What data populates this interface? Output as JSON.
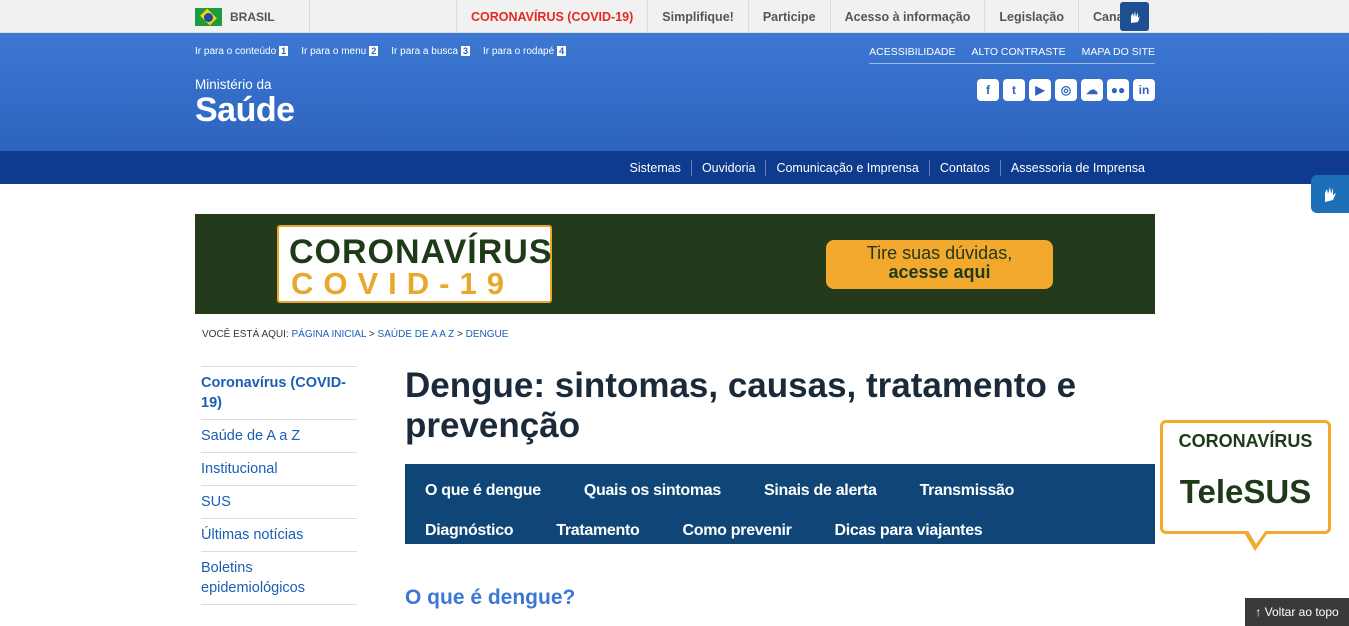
{
  "gov_bar": {
    "country": "BRASIL",
    "links": [
      {
        "label": "CORONAVÍRUS (COVID-19)"
      },
      {
        "label": "Simplifique!"
      },
      {
        "label": "Participe"
      },
      {
        "label": "Acesso à informação"
      },
      {
        "label": "Legislação"
      },
      {
        "label": "Canais"
      }
    ]
  },
  "skip_links": [
    {
      "label": "Ir para o conteúdo",
      "key": "1"
    },
    {
      "label": "Ir para o menu",
      "key": "2"
    },
    {
      "label": "Ir para a busca",
      "key": "3"
    },
    {
      "label": "Ir para o rodapé",
      "key": "4"
    }
  ],
  "access_links": [
    "ACESSIBILIDADE",
    "ALTO CONTRASTE",
    "MAPA DO SITE"
  ],
  "brand": {
    "small": "Ministério da",
    "big": "Saúde"
  },
  "social_icons": [
    "facebook-icon",
    "twitter-icon",
    "youtube-icon",
    "instagram-icon",
    "soundcloud-icon",
    "flickr-icon",
    "linkedin-icon"
  ],
  "social_glyphs": [
    "f",
    "t",
    "▶",
    "◎",
    "☁",
    "●●",
    "in"
  ],
  "main_nav": [
    "Sistemas",
    "Ouvidoria",
    "Comunicação e Imprensa",
    "Contatos",
    "Assessoria de Imprensa"
  ],
  "banner": {
    "line1": "CORONAVÍRUS",
    "line2": "COVID-19",
    "button_line1": "Tire suas dúvidas,",
    "button_line2": "acesse aqui"
  },
  "breadcrumb": {
    "prefix": "VOCÊ ESTÁ AQUI:",
    "items": [
      "PÁGINA INICIAL",
      "SAÚDE DE A A Z",
      "DENGUE"
    ],
    "separator": ">"
  },
  "sidebar": [
    {
      "label": "Coronavírus (COVID-19)",
      "active": true
    },
    {
      "label": "Saúde de A a Z"
    },
    {
      "label": "Institucional"
    },
    {
      "label": "SUS"
    },
    {
      "label": "Últimas notícias"
    },
    {
      "label": "Boletins epidemiológicos"
    }
  ],
  "page_title": "Dengue: sintomas, causas, tratamento e prevenção",
  "tabs_row1": [
    "O que é dengue",
    "Quais os sintomas",
    "Sinais de alerta",
    "Transmissão"
  ],
  "tabs_row2": [
    "Diagnóstico",
    "Tratamento",
    "Como prevenir",
    "Dicas para viajantes"
  ],
  "section_heading": "O que é dengue?",
  "telesus": {
    "line1": "CORONAVÍRUS",
    "line2": "TeleSUS"
  },
  "back_to_top": "↑ Voltar ao topo",
  "colors": {
    "header_blue": "#2d63bf",
    "nav_dark": "#0f3b8e",
    "banner_green": "#233b1b",
    "accent_orange": "#f2a92e",
    "tab_blue": "#0f4677"
  }
}
